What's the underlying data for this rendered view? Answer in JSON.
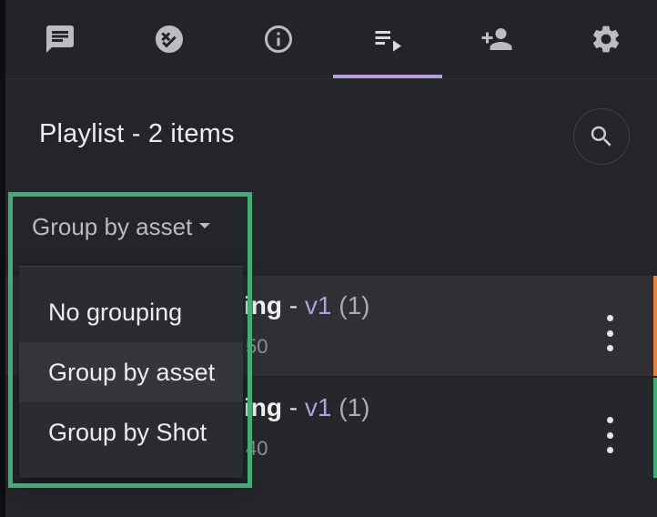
{
  "tabs": [
    {
      "name": "comments",
      "icon": "comment-icon"
    },
    {
      "name": "checklist",
      "icon": "ticked-off-icon"
    },
    {
      "name": "info",
      "icon": "info-icon"
    },
    {
      "name": "playlist",
      "icon": "playlist-icon",
      "active": true
    },
    {
      "name": "add-person",
      "icon": "person-add-icon"
    },
    {
      "name": "settings",
      "icon": "gear-icon"
    }
  ],
  "panel": {
    "title": "Playlist - 2 items",
    "search_icon": "search-icon"
  },
  "group_select": {
    "value": "Group by asset",
    "options": [
      "No grouping",
      "Group by asset",
      "Group by Shot"
    ],
    "selected_index": 1
  },
  "rows": [
    {
      "name_partial": "ing",
      "separator": " - ",
      "version": "v1",
      "count": "(1)",
      "sub_partial": "50",
      "status_color": "#e0823d"
    },
    {
      "name_partial": "ing",
      "separator": " - ",
      "version": "v1",
      "count": "(1)",
      "sub_partial": "40",
      "status_color": "#3fae72"
    }
  ],
  "colors": {
    "accent": "#b39ddb",
    "highlight_border": "#3fae72"
  }
}
